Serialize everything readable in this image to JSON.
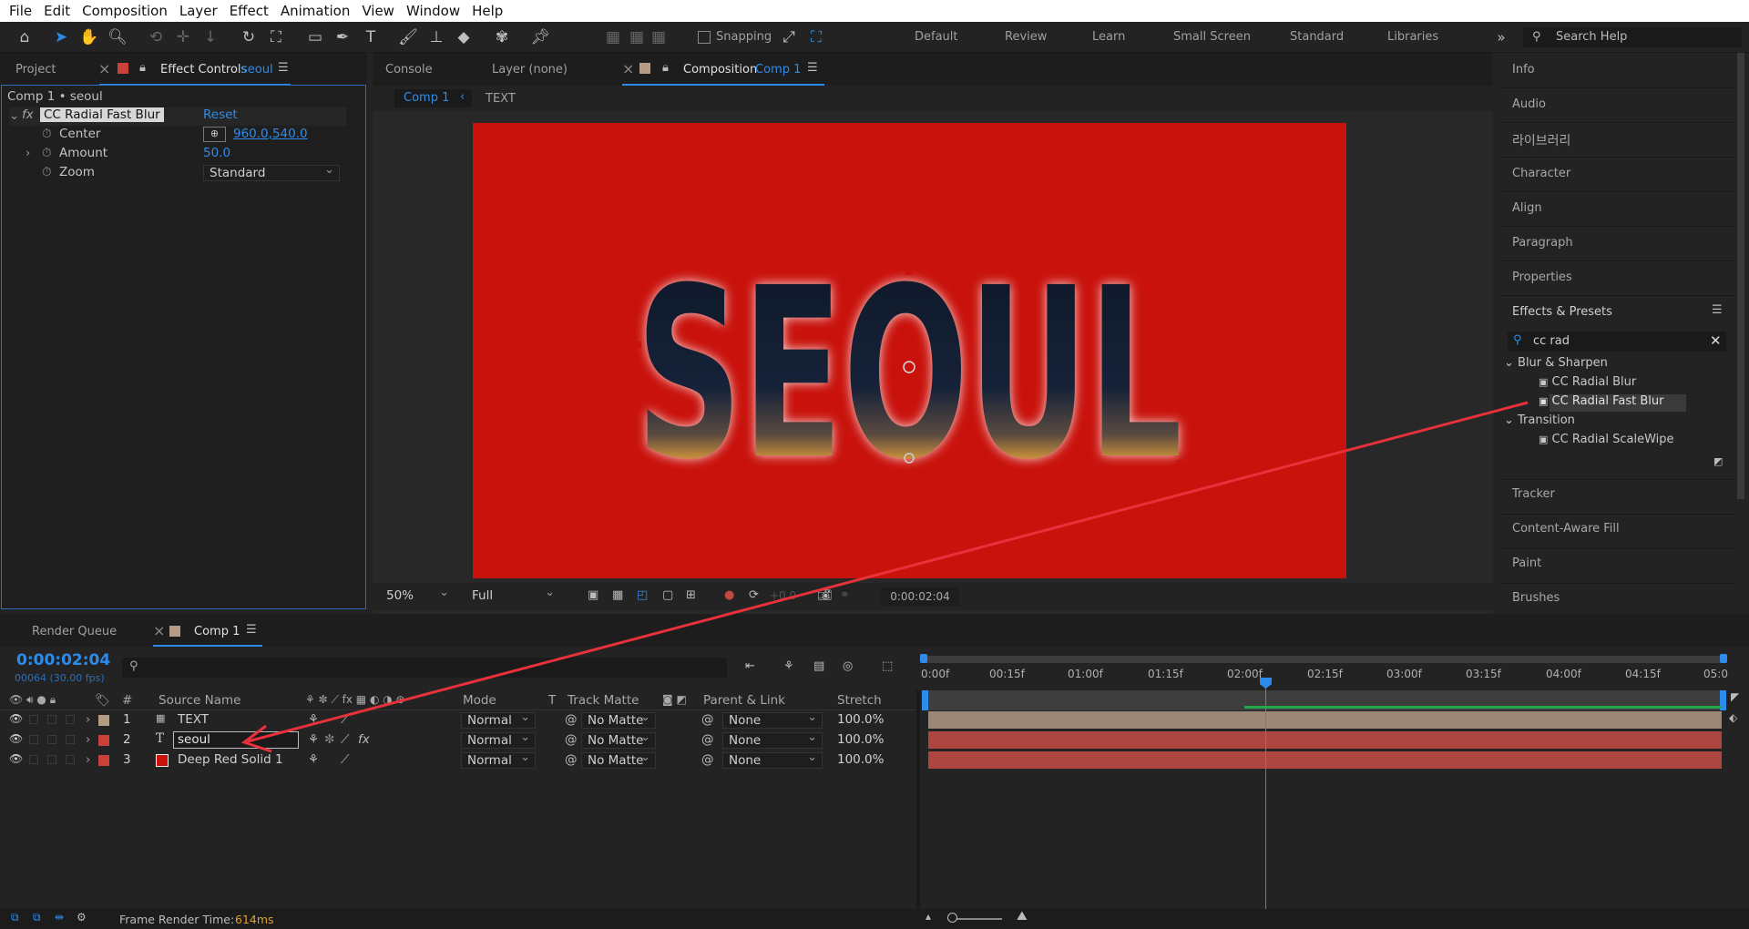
{
  "menu": [
    "File",
    "Edit",
    "Composition",
    "Layer",
    "Effect",
    "Animation",
    "View",
    "Window",
    "Help"
  ],
  "toolbar": {
    "snapping": "Snapping",
    "workspaces": [
      "Default",
      "Review",
      "Learn",
      "Small Screen",
      "Standard",
      "Libraries"
    ],
    "search_help": "Search Help"
  },
  "left_panel": {
    "tab_project": "Project",
    "tab_effect_controls": "Effect Controls",
    "ec_layer": "seoul",
    "breadcrumb": "Comp 1 • seoul",
    "effect_name": "CC Radial Fast Blur",
    "reset": "Reset",
    "params": [
      {
        "label": "Center",
        "value": "960.0,540.0"
      },
      {
        "label": "Amount",
        "value": "50.0"
      },
      {
        "label": "Zoom",
        "value": "Standard"
      }
    ]
  },
  "comp_panel": {
    "tab_console": "Console",
    "tab_layer": "Layer (none)",
    "tab_composition": "Composition",
    "comp_name": "Comp 1",
    "flow_comp": "Comp 1",
    "flow_text": "TEXT",
    "canvas_text": "SEOUL",
    "canvas_bg": "#c9120c",
    "zoom": "50%",
    "resolution": "Full",
    "exposure": "+0.0",
    "timecode": "0:00:02:04"
  },
  "right_panel": {
    "items": [
      "Info",
      "Audio",
      "라이브러리",
      "Character",
      "Align",
      "Paragraph",
      "Properties"
    ],
    "effects_title": "Effects & Presets",
    "search_value": "cc rad",
    "tree": [
      {
        "group": "Blur & Sharpen",
        "items": [
          "CC Radial Blur",
          "CC Radial Fast Blur"
        ]
      },
      {
        "group": "Transition",
        "items": [
          "CC Radial ScaleWipe"
        ]
      }
    ],
    "lower_items": [
      "Tracker",
      "Content-Aware Fill",
      "Paint",
      "Brushes"
    ]
  },
  "timeline": {
    "tab_render": "Render Queue",
    "tab_comp": "Comp 1",
    "timecode": "0:00:02:04",
    "frame_info": "00064 (30.00 fps)",
    "columns": {
      "num": "#",
      "source": "Source Name",
      "mode": "Mode",
      "t": "T",
      "matte": "Track Matte",
      "parent": "Parent & Link",
      "stretch": "Stretch"
    },
    "layers": [
      {
        "num": "1",
        "name": "TEXT",
        "color": "#b59a84",
        "mode": "Normal",
        "matte": "No Matte",
        "parent": "None",
        "stretch": "100.0%"
      },
      {
        "num": "2",
        "name": "seoul",
        "color": "#c9413a",
        "mode": "Normal",
        "matte": "No Matte",
        "parent": "None",
        "stretch": "100.0%"
      },
      {
        "num": "3",
        "name": "Deep Red Solid 1",
        "color": "#c9413a",
        "mode": "Normal",
        "matte": "No Matte",
        "parent": "None",
        "stretch": "100.0%"
      }
    ],
    "ruler": [
      "0:00f",
      "00:15f",
      "01:00f",
      "01:15f",
      "02:00f",
      "02:15f",
      "03:00f",
      "03:15f",
      "04:00f",
      "04:15f",
      "05:0"
    ],
    "playhead": "0:00:02:04"
  },
  "status": {
    "frame_render_label": "Frame Render Time:",
    "frame_render_value": "614ms"
  },
  "colors": {
    "accent": "#2d8ceb",
    "red_annotation": "#e8313a"
  }
}
